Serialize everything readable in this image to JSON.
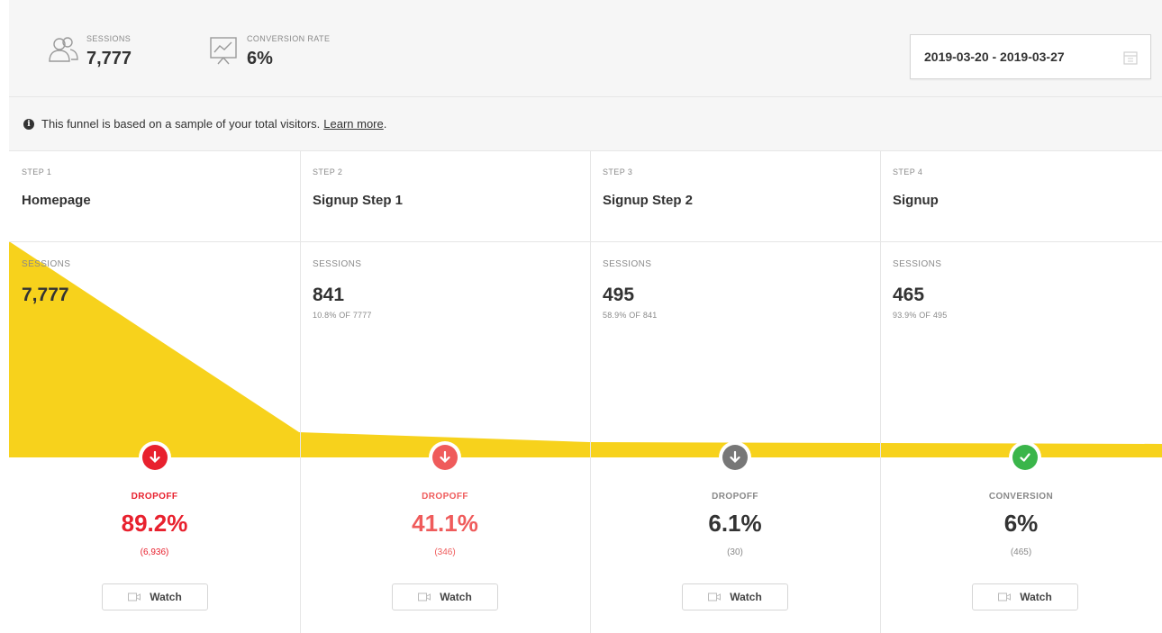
{
  "header": {
    "sessions": {
      "label": "SESSIONS",
      "value": "7,777",
      "icon": "users-icon"
    },
    "conversion": {
      "label": "CONVERSION RATE",
      "value": "6%",
      "icon": "chart-presentation-icon"
    },
    "date_range": "2019-03-20 - 2019-03-27"
  },
  "notice": {
    "text": "This funnel is based on a sample of your total visitors.",
    "link": "Learn more",
    "suffix": "."
  },
  "colors": {
    "funnel": "#f7d21c",
    "dropoff_red": "#e8212e",
    "dropoff_light_red": "#ef5b5b",
    "dropoff_gray": "#777777",
    "conversion_green": "#3ab54a"
  },
  "steps": [
    {
      "step": "STEP 1",
      "name": "Homepage",
      "sessions_label": "SESSIONS",
      "sessions": "7,777",
      "sub": "",
      "outcome_label": "DROPOFF",
      "outcome_pct": "89.2%",
      "outcome_count": "(6,936)",
      "watch": "Watch",
      "outcome_kind": "dropoff-red"
    },
    {
      "step": "STEP 2",
      "name": "Signup Step 1",
      "sessions_label": "SESSIONS",
      "sessions": "841",
      "sub": "10.8% OF 7777",
      "outcome_label": "DROPOFF",
      "outcome_pct": "41.1%",
      "outcome_count": "(346)",
      "watch": "Watch",
      "outcome_kind": "dropoff-light-red"
    },
    {
      "step": "STEP 3",
      "name": "Signup Step 2",
      "sessions_label": "SESSIONS",
      "sessions": "495",
      "sub": "58.9% OF 841",
      "outcome_label": "DROPOFF",
      "outcome_pct": "6.1%",
      "outcome_count": "(30)",
      "watch": "Watch",
      "outcome_kind": "dropoff-gray"
    },
    {
      "step": "STEP 4",
      "name": "Signup",
      "sessions_label": "SESSIONS",
      "sessions": "465",
      "sub": "93.9% OF 495",
      "outcome_label": "CONVERSION",
      "outcome_pct": "6%",
      "outcome_count": "(465)",
      "watch": "Watch",
      "outcome_kind": "conversion-green"
    }
  ]
}
